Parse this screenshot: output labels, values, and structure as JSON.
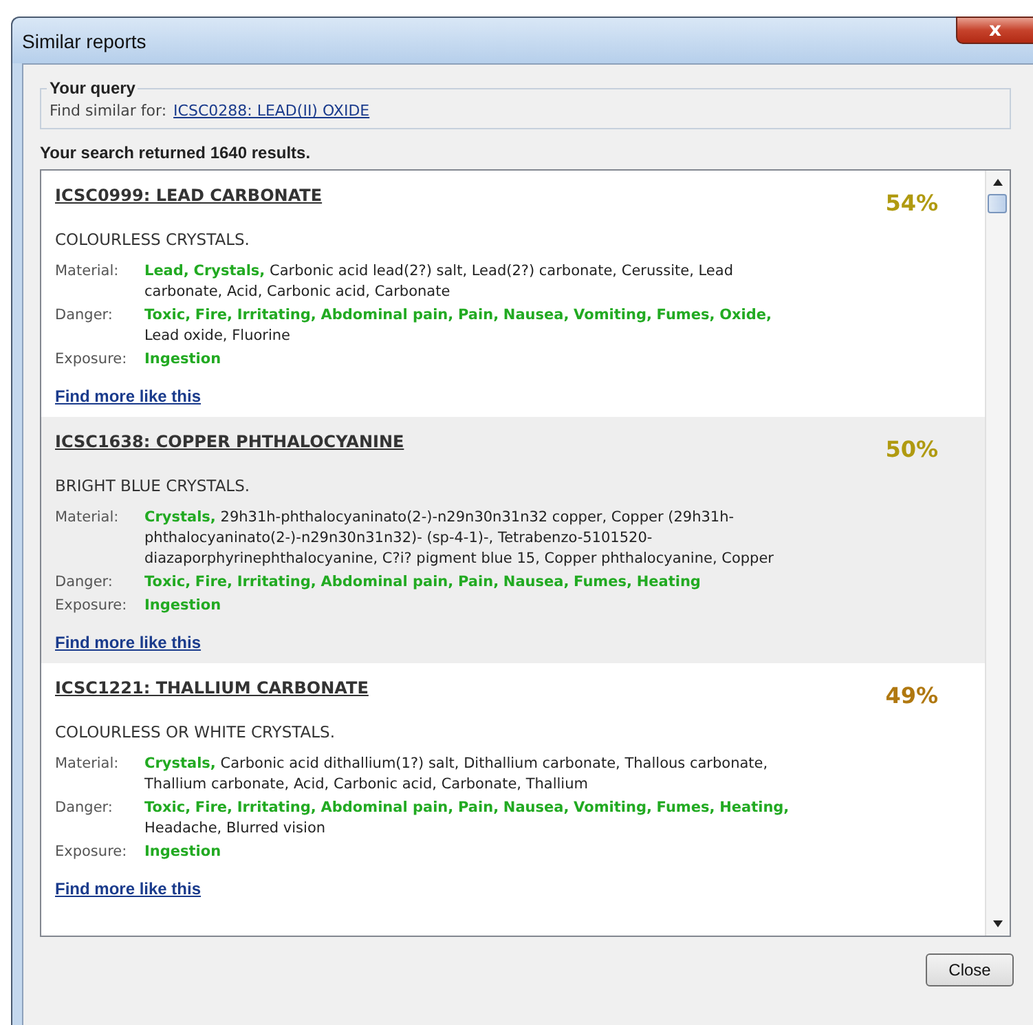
{
  "window": {
    "title": "Similar reports",
    "close": "x"
  },
  "query": {
    "legend": "Your query",
    "label": "Find similar for:",
    "link": "ICSC0288: LEAD(II) OXIDE"
  },
  "summary": "Your search returned 1640 results.",
  "results": [
    {
      "title": "ICSC0999: LEAD CARBONATE",
      "score": "54%",
      "color": "#b09a10",
      "description": "COLOURLESS CRYSTALS.",
      "fields": [
        {
          "label": "Material:",
          "terms": [
            {
              "text": "Lead,",
              "matched": true
            },
            {
              "text": "Crystals,",
              "matched": true
            },
            {
              "text": "Carbonic acid lead(2?) salt,",
              "matched": false
            },
            {
              "text": "Lead(2?) carbonate,",
              "matched": false
            },
            {
              "text": "Cerussite,",
              "matched": false
            },
            {
              "text": "Lead carbonate,",
              "matched": false
            },
            {
              "text": "Acid,",
              "matched": false
            },
            {
              "text": "Carbonic acid,",
              "matched": false
            },
            {
              "text": "Carbonate",
              "matched": false
            }
          ]
        },
        {
          "label": "Danger:",
          "terms": [
            {
              "text": "Toxic,",
              "matched": true
            },
            {
              "text": "Fire,",
              "matched": true
            },
            {
              "text": "Irritating,",
              "matched": true
            },
            {
              "text": "Abdominal pain,",
              "matched": true
            },
            {
              "text": "Pain,",
              "matched": true
            },
            {
              "text": "Nausea,",
              "matched": true
            },
            {
              "text": "Vomiting,",
              "matched": true
            },
            {
              "text": "Fumes,",
              "matched": true
            },
            {
              "text": "Oxide,",
              "matched": true
            },
            {
              "text": "Lead oxide,",
              "matched": false
            },
            {
              "text": "Fluorine",
              "matched": false
            }
          ]
        },
        {
          "label": "Exposure:",
          "terms": [
            {
              "text": "Ingestion",
              "matched": true
            }
          ]
        }
      ],
      "more": "Find more like this"
    },
    {
      "title": "ICSC1638: COPPER PHTHALOCYANINE",
      "score": "50%",
      "color": "#b09a10",
      "description": "BRIGHT BLUE CRYSTALS.",
      "fields": [
        {
          "label": "Material:",
          "terms": [
            {
              "text": "Crystals,",
              "matched": true
            },
            {
              "text": "29h31h-phthalocyaninato(2-)-n29n30n31n32 copper,",
              "matched": false
            },
            {
              "text": "Copper (29h31h-phthalocyaninato(2-)-n29n30n31n32)- (sp-4-1)-,",
              "matched": false
            },
            {
              "text": "Tetrabenzo-5101520-diazaporphyrinephthalocyanine,",
              "matched": false
            },
            {
              "text": "C?i? pigment blue 15,",
              "matched": false
            },
            {
              "text": "Copper phthalocyanine,",
              "matched": false
            },
            {
              "text": "Copper",
              "matched": false
            }
          ]
        },
        {
          "label": "Danger:",
          "terms": [
            {
              "text": "Toxic,",
              "matched": true
            },
            {
              "text": "Fire,",
              "matched": true
            },
            {
              "text": "Irritating,",
              "matched": true
            },
            {
              "text": "Abdominal pain,",
              "matched": true
            },
            {
              "text": "Pain,",
              "matched": true
            },
            {
              "text": "Nausea,",
              "matched": true
            },
            {
              "text": "Fumes,",
              "matched": true
            },
            {
              "text": "Heating",
              "matched": true
            }
          ]
        },
        {
          "label": "Exposure:",
          "terms": [
            {
              "text": "Ingestion",
              "matched": true
            }
          ]
        }
      ],
      "more": "Find more like this"
    },
    {
      "title": "ICSC1221: THALLIUM CARBONATE",
      "score": "49%",
      "color": "#b07810",
      "description": "COLOURLESS OR WHITE CRYSTALS.",
      "fields": [
        {
          "label": "Material:",
          "terms": [
            {
              "text": "Crystals,",
              "matched": true
            },
            {
              "text": "Carbonic acid dithallium(1?) salt,",
              "matched": false
            },
            {
              "text": "Dithallium carbonate,",
              "matched": false
            },
            {
              "text": "Thallous carbonate,",
              "matched": false
            },
            {
              "text": "Thallium carbonate,",
              "matched": false
            },
            {
              "text": "Acid,",
              "matched": false
            },
            {
              "text": "Carbonic acid,",
              "matched": false
            },
            {
              "text": "Carbonate,",
              "matched": false
            },
            {
              "text": "Thallium",
              "matched": false
            }
          ]
        },
        {
          "label": "Danger:",
          "terms": [
            {
              "text": "Toxic,",
              "matched": true
            },
            {
              "text": "Fire,",
              "matched": true
            },
            {
              "text": "Irritating,",
              "matched": true
            },
            {
              "text": "Abdominal pain,",
              "matched": true
            },
            {
              "text": "Pain,",
              "matched": true
            },
            {
              "text": "Nausea,",
              "matched": true
            },
            {
              "text": "Vomiting,",
              "matched": true
            },
            {
              "text": "Fumes,",
              "matched": true
            },
            {
              "text": "Heating,",
              "matched": true
            },
            {
              "text": "Headache,",
              "matched": false
            },
            {
              "text": "Blurred vision",
              "matched": false
            }
          ]
        },
        {
          "label": "Exposure:",
          "terms": [
            {
              "text": "Ingestion",
              "matched": true
            }
          ]
        }
      ],
      "more": "Find more like this"
    }
  ],
  "buttons": [
    "Close"
  ]
}
